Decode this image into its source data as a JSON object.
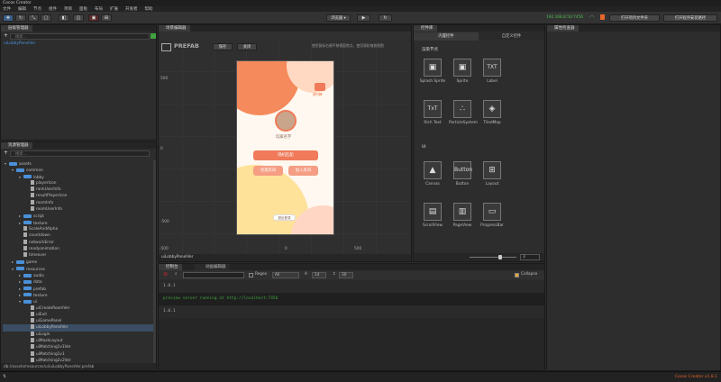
{
  "app": {
    "title": "Cocos Creator"
  },
  "menu": [
    "文件",
    "编辑",
    "节点",
    "组件",
    "项目",
    "面板",
    "布局",
    "扩展",
    "开发者",
    "帮助"
  ],
  "toolbar": {
    "device": "浏览器 ▾",
    "ip": "192.168.8.50:7456",
    "open_project_btn": "打开项目文件夹",
    "open_program_btn": "打开程序安装路径"
  },
  "hierarchy": {
    "title": "层级管理器",
    "search_placeholder": "搜索...",
    "root": "uiLobbyPanelVer"
  },
  "assets": {
    "title": "资源管理器",
    "search_placeholder": "搜索...",
    "items": [
      {
        "label": "assets",
        "depth": 0,
        "type": "folder",
        "open": true
      },
      {
        "label": "common",
        "depth": 1,
        "type": "folder",
        "open": true
      },
      {
        "label": "lobby",
        "depth": 2,
        "type": "folder",
        "open": true
      },
      {
        "label": "playerIcon",
        "depth": 3,
        "type": "file"
      },
      {
        "label": "rankUserInfo",
        "depth": 3,
        "type": "file"
      },
      {
        "label": "resultPlayerIcon",
        "depth": 3,
        "type": "file"
      },
      {
        "label": "roomInfo",
        "depth": 3,
        "type": "file"
      },
      {
        "label": "roomUserInfo",
        "depth": 3,
        "type": "file"
      },
      {
        "label": "script",
        "depth": 2,
        "type": "folder",
        "open": false
      },
      {
        "label": "texture",
        "depth": 2,
        "type": "folder",
        "open": false
      },
      {
        "label": "ScaleAndAlpha",
        "depth": 2,
        "type": "file"
      },
      {
        "label": "countdown",
        "depth": 2,
        "type": "file"
      },
      {
        "label": "networkError",
        "depth": 2,
        "type": "file"
      },
      {
        "label": "readyanimation",
        "depth": 2,
        "type": "file"
      },
      {
        "label": "timeover",
        "depth": 2,
        "type": "file"
      },
      {
        "label": "game",
        "depth": 1,
        "type": "folder",
        "open": false
      },
      {
        "label": "resources",
        "depth": 1,
        "type": "folder",
        "open": true
      },
      {
        "label": "audio",
        "depth": 2,
        "type": "folder",
        "open": false
      },
      {
        "label": "data",
        "depth": 2,
        "type": "folder",
        "open": false
      },
      {
        "label": "prefab",
        "depth": 2,
        "type": "folder",
        "open": false
      },
      {
        "label": "texture",
        "depth": 2,
        "type": "folder",
        "open": false
      },
      {
        "label": "ui",
        "depth": 2,
        "type": "folder",
        "open": true
      },
      {
        "label": "uiCreateRoomVer",
        "depth": 3,
        "type": "file"
      },
      {
        "label": "uiExit",
        "depth": 3,
        "type": "file"
      },
      {
        "label": "uiGamePanel",
        "depth": 3,
        "type": "file"
      },
      {
        "label": "uiLobbyPanelVer",
        "depth": 3,
        "type": "file",
        "selected": true
      },
      {
        "label": "uiLogin",
        "depth": 3,
        "type": "file"
      },
      {
        "label": "uiMaskLayout",
        "depth": 3,
        "type": "file"
      },
      {
        "label": "uiMatching1v1Ver",
        "depth": 3,
        "type": "file"
      },
      {
        "label": "uiMatching1v1",
        "depth": 3,
        "type": "file"
      },
      {
        "label": "uiMatching2v2Ver",
        "depth": 3,
        "type": "file"
      }
    ],
    "status_path": "db://assets/resources/ui/uiLobbyPanelVer.prefab"
  },
  "scene": {
    "title": "场景编辑器",
    "prefab_label": "PREFAB",
    "save_btn": "保存",
    "close_btn": "关闭",
    "hint": "使用鼠标右键平移视窗焦点，使用滚轮缩放视图",
    "axis_y": [
      "500",
      "0",
      "-500"
    ],
    "axis_x": [
      "-500",
      "0",
      "500"
    ],
    "footer": "uiLobbyPanelVer",
    "preview": {
      "username": "玩家名字",
      "badge": "排行榜",
      "btn_match": "随机匹配",
      "btn_create": "创建房间",
      "btn_join": "加入房间",
      "btn_exit": "退出登录"
    }
  },
  "library": {
    "title": "控件库",
    "tab_builtin": "内置控件",
    "tab_custom": "自定义控件",
    "section_render": "渲染节点",
    "section_ui": "UI",
    "render_items": [
      {
        "label": "Splash Sprite",
        "glyph": "▣"
      },
      {
        "label": "Sprite",
        "glyph": "▣"
      },
      {
        "label": "Label",
        "glyph": "TXT"
      },
      {
        "label": "Rich Text",
        "glyph": "TxT"
      },
      {
        "label": "ParticleSystem",
        "glyph": "∴"
      },
      {
        "label": "TiledMap",
        "glyph": "◈"
      }
    ],
    "ui_items": [
      {
        "label": "Canvas",
        "glyph": "▲"
      },
      {
        "label": "Button",
        "glyph": "Button"
      },
      {
        "label": "Layout",
        "glyph": "⊞"
      },
      {
        "label": "ScrollView",
        "glyph": "▤"
      },
      {
        "label": "PageView",
        "glyph": "▥"
      },
      {
        "label": "ProgressBar",
        "glyph": "▭"
      }
    ],
    "zoom_value": "3"
  },
  "inspector": {
    "title": "属性检查器"
  },
  "console": {
    "tab_console": "控制台",
    "tab_anim": "动画编辑器",
    "regex_label": "Regex",
    "filter_level": "All",
    "font_size": "14",
    "line_height": "30",
    "collapse_label": "Collapse",
    "lines": [
      {
        "text": "1.0.1",
        "color": "#aaaaaa"
      },
      {
        "text": "preview server running at http://localhost:7456",
        "color": "#3fa33f"
      },
      {
        "text": "1.0.1",
        "color": "#aaaaaa"
      }
    ]
  },
  "status": {
    "version": "Cocos Creator v1.8.1"
  },
  "colors": {
    "accent": "#4a90d9",
    "brand": "#e8652a",
    "preview_btn": "#f07a5a"
  }
}
